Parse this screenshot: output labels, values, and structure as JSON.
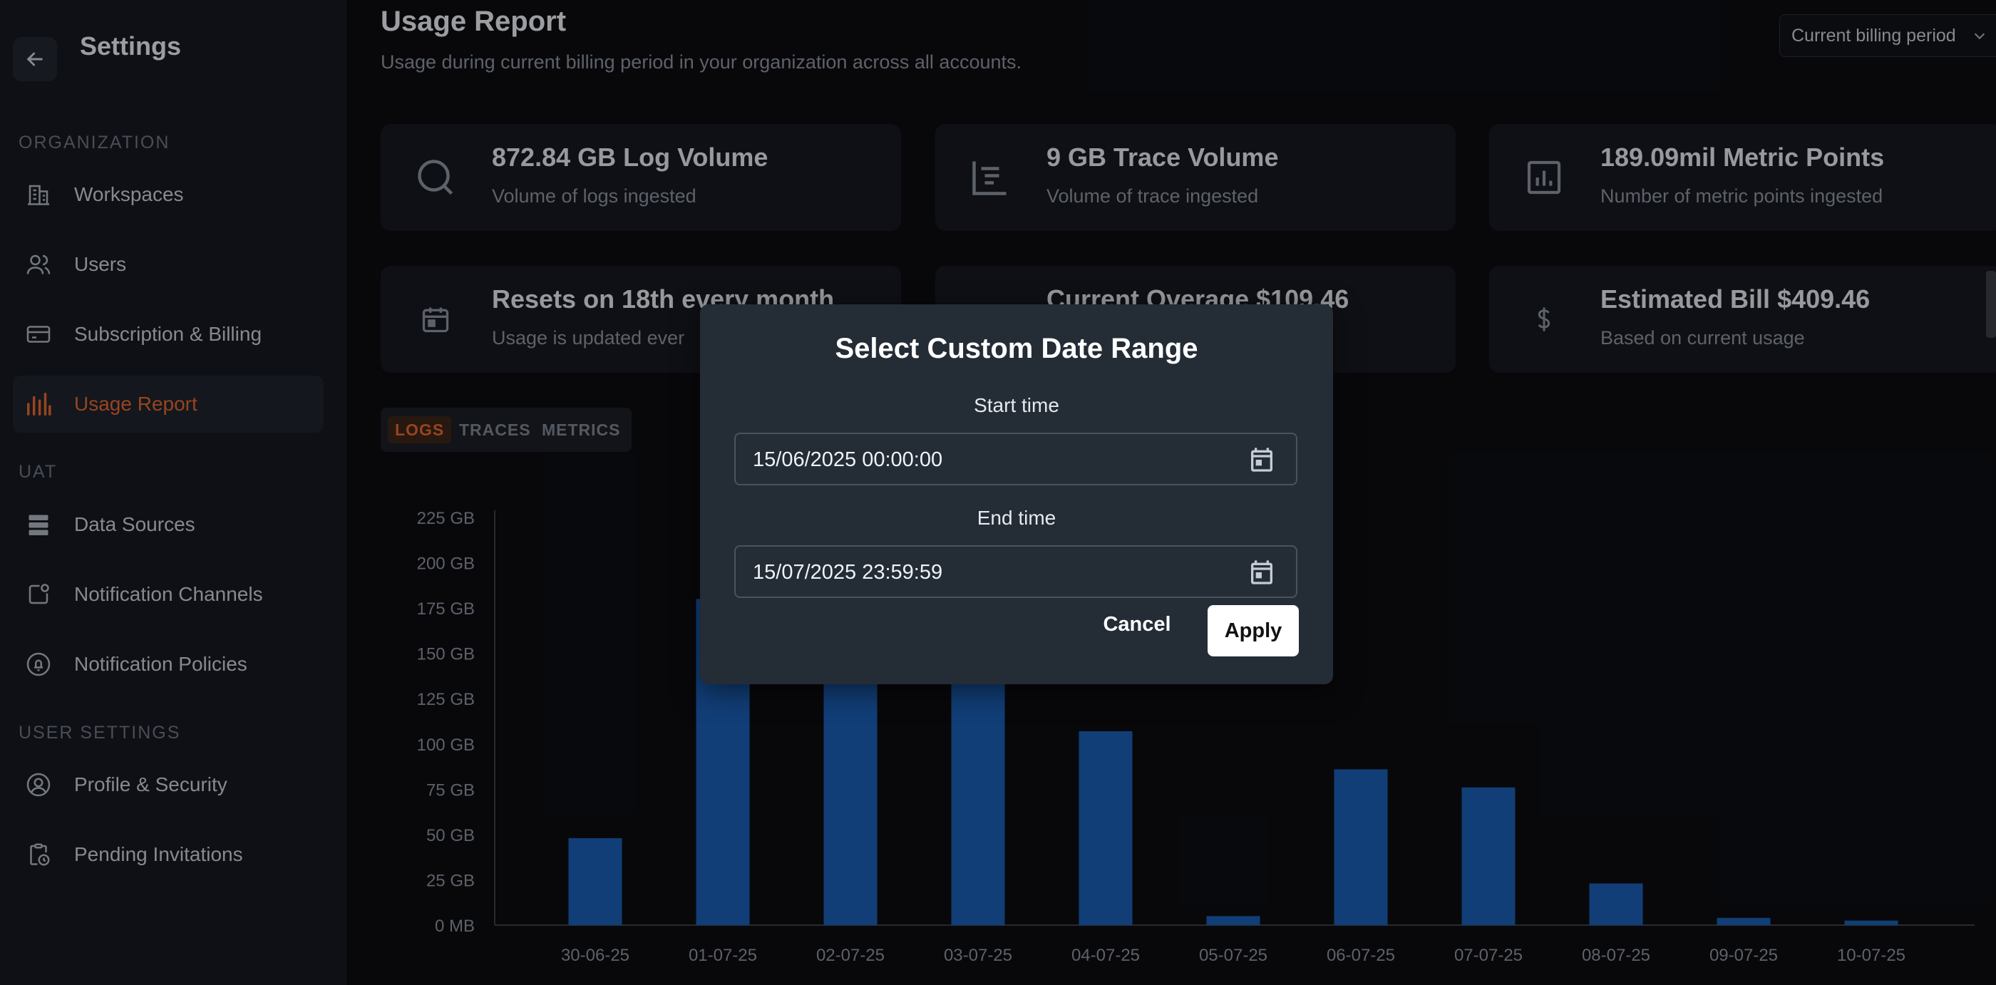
{
  "sidebar": {
    "title": "Settings",
    "sections": {
      "organization": "ORGANIZATION",
      "uat": "UAT",
      "user_settings": "USER SETTINGS"
    },
    "items": [
      {
        "label": "Workspaces",
        "icon": "building-icon"
      },
      {
        "label": "Users",
        "icon": "users-icon"
      },
      {
        "label": "Subscription & Billing",
        "icon": "credit-card-icon"
      },
      {
        "label": "Usage Report",
        "icon": "bar-chart-icon",
        "active": true
      },
      {
        "label": "Data Sources",
        "icon": "database-icon"
      },
      {
        "label": "Notification Channels",
        "icon": "notification-icon"
      },
      {
        "label": "Notification Policies",
        "icon": "bell-icon"
      },
      {
        "label": "Profile & Security",
        "icon": "user-circle-icon"
      },
      {
        "label": "Pending Invitations",
        "icon": "clipboard-clock-icon"
      }
    ]
  },
  "header": {
    "title": "Usage Report",
    "subtitle": "Usage during current billing period in your organization across all accounts.",
    "period_select": "Current billing period"
  },
  "cards": [
    {
      "title": "872.84 GB Log Volume",
      "subtitle": "Volume of logs ingested",
      "icon": "search-icon"
    },
    {
      "title": "9 GB Trace Volume",
      "subtitle": "Volume of trace ingested",
      "icon": "trace-icon"
    },
    {
      "title": "189.09mil Metric Points",
      "subtitle": "Number of metric points ingested",
      "icon": "chart-box-icon"
    },
    {
      "title": "Resets on 18th every month",
      "subtitle": "Usage is updated ever",
      "icon": "calendar-icon"
    },
    {
      "title": "Current Overage $109.46",
      "subtitle": "",
      "icon": ""
    },
    {
      "title": "Estimated Bill $409.46",
      "subtitle": "Based on current usage",
      "icon": "dollar-icon"
    }
  ],
  "tabs": [
    {
      "label": "LOGS",
      "active": true
    },
    {
      "label": "TRACES"
    },
    {
      "label": "METRICS"
    }
  ],
  "chart_data": {
    "type": "bar",
    "categories": [
      "30-06-25",
      "01-07-25",
      "02-07-25",
      "03-07-25",
      "04-07-25",
      "05-07-25",
      "06-07-25",
      "07-07-25",
      "08-07-25",
      "09-07-25",
      "10-07-25"
    ],
    "values": [
      48,
      180,
      160,
      150,
      107,
      5,
      86,
      76,
      23,
      4,
      2.5
    ],
    "y_ticks": [
      "0 MB",
      "25 GB",
      "50 GB",
      "75 GB",
      "100 GB",
      "125 GB",
      "150 GB",
      "175 GB",
      "200 GB",
      "225 GB"
    ],
    "ylim": [
      0,
      225
    ],
    "color": "#1a5cb0"
  },
  "modal": {
    "title": "Select Custom Date Range",
    "start_label": "Start time",
    "start_value": "15/06/2025 00:00:00",
    "end_label": "End time",
    "end_value": "15/07/2025 23:59:59",
    "cancel": "Cancel",
    "apply": "Apply"
  },
  "colors": {
    "accent": "#e0652e",
    "bar": "#1a5cb0",
    "modal_bg": "#242c36"
  }
}
